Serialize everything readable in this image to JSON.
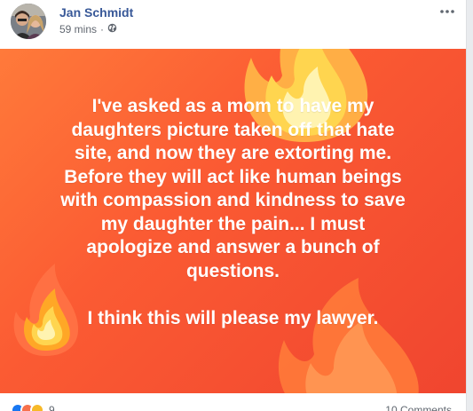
{
  "post": {
    "author_name": "Jan Schmidt",
    "time": "59 mins",
    "separator": "·",
    "audience_icon": "globe-icon",
    "more_icon": "more-options-icon",
    "text": "I've asked as a mom to have my\ndaughters picture taken off that hate\nsite, and now they are extorting me.\nBefore they will act like human beings\nwith compassion and kindness to save\nmy daughter the pain... I must\napologize and answer a bunch of\nquestions.\n\nI think this will please my lawyer.",
    "background": {
      "colors": [
        "#ff7a3a",
        "#fb5b33",
        "#f0452f"
      ],
      "decoration": "fire-emoji"
    }
  },
  "footer": {
    "reaction_icons": [
      "like-icon",
      "angry-icon",
      "wow-icon"
    ],
    "reaction_colors": [
      "#1877f2",
      "#f7714c",
      "#f7b928"
    ],
    "reaction_count": "9",
    "comments": "10 Comments"
  }
}
